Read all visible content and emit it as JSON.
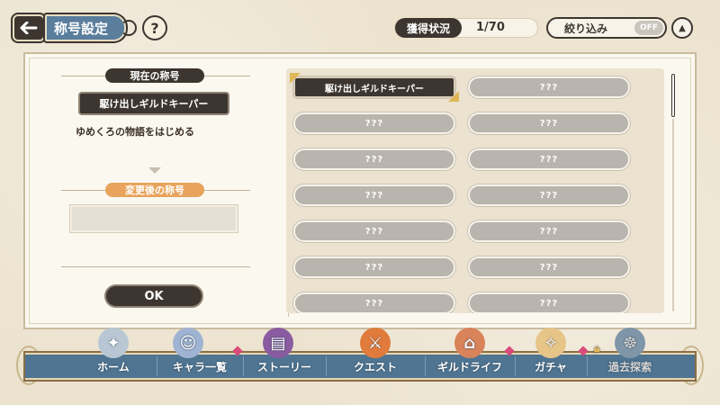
{
  "header": {
    "back_icon": "back-arrow-icon",
    "title": "称号設定",
    "help": "?",
    "acquisition_label": "獲得状況",
    "acquisition_value": "1/70",
    "filter_label": "絞り込み",
    "filter_state": "OFF",
    "scroll_top_icon": "triangle-up-icon"
  },
  "left": {
    "current_header": "現在の称号",
    "current_title": "駆け出しギルドキーパー",
    "current_description": "ゆめくろの物語をはじめる",
    "new_header": "変更後の称号",
    "new_title_value": "",
    "ok_label": "OK"
  },
  "titles": [
    {
      "label": "駆け出しギルドキーパー",
      "owned": true
    },
    {
      "label": "???",
      "owned": false
    },
    {
      "label": "???",
      "owned": false
    },
    {
      "label": "???",
      "owned": false
    },
    {
      "label": "???",
      "owned": false
    },
    {
      "label": "???",
      "owned": false
    },
    {
      "label": "???",
      "owned": false
    },
    {
      "label": "???",
      "owned": false
    },
    {
      "label": "???",
      "owned": false
    },
    {
      "label": "???",
      "owned": false
    },
    {
      "label": "???",
      "owned": false
    },
    {
      "label": "???",
      "owned": false
    },
    {
      "label": "???",
      "owned": false
    },
    {
      "label": "???",
      "owned": false
    }
  ],
  "nav": [
    {
      "label": "ホーム",
      "icon": "compass-icon"
    },
    {
      "label": "キャラ一覧",
      "icon": "characters-icon"
    },
    {
      "label": "ストーリー",
      "icon": "book-icon"
    },
    {
      "label": "クエスト",
      "icon": "quest-icon"
    },
    {
      "label": "ギルドライフ",
      "icon": "house-icon"
    },
    {
      "label": "ガチャ",
      "icon": "gacha-icon"
    },
    {
      "label": "過去探索",
      "icon": "ship-wheel-icon"
    }
  ],
  "colors": {
    "dark": "#3d3630",
    "accent_blue": "#5a7e9c",
    "accent_orange": "#e8a45c",
    "nav_blue": "#4f7592",
    "panel": "#fbf8f0"
  }
}
